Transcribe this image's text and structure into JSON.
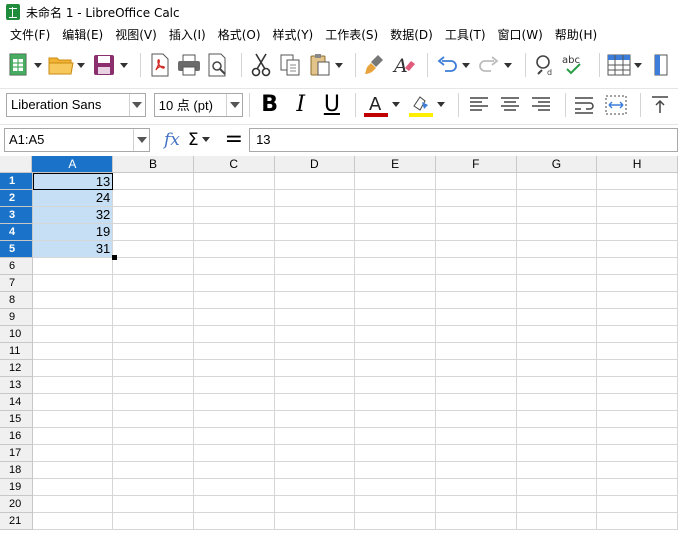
{
  "window": {
    "title": "未命名 1 - LibreOffice Calc"
  },
  "menu": [
    "文件(F)",
    "编辑(E)",
    "视图(V)",
    "插入(I)",
    "格式(O)",
    "样式(Y)",
    "工作表(S)",
    "数据(D)",
    "工具(T)",
    "窗口(W)",
    "帮助(H)"
  ],
  "format": {
    "font_name": "Liberation Sans",
    "font_size": "10 点 (pt)",
    "spell_label": "abc"
  },
  "formula": {
    "name_box": "A1:A5",
    "content": "13",
    "fx": "fx",
    "sigma": "Σ",
    "equals": "="
  },
  "sheet": {
    "columns": [
      "A",
      "B",
      "C",
      "D",
      "E",
      "F",
      "G",
      "H"
    ],
    "rows": [
      "1",
      "2",
      "3",
      "4",
      "5",
      "6",
      "7",
      "8",
      "9",
      "10",
      "11",
      "12",
      "13",
      "14",
      "15",
      "16",
      "17",
      "18",
      "19",
      "20",
      "21"
    ],
    "column_a_values": [
      "13",
      "24",
      "32",
      "19",
      "31"
    ]
  },
  "colors": {
    "accent": "#1a73c8",
    "selection": "#c6dff5",
    "font_color": "#c00000",
    "highlight": "#ffee00"
  }
}
